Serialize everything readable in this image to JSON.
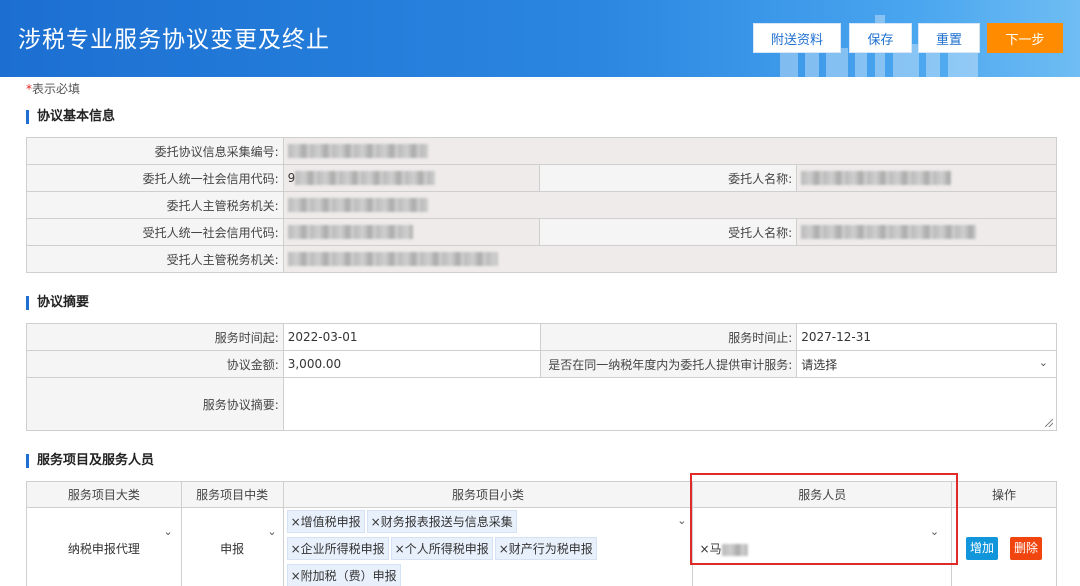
{
  "header": {
    "title": "涉税专业服务协议变更及终止",
    "buttons": {
      "attach": "附送资料",
      "save": "保存",
      "reset": "重置",
      "next": "下一步"
    }
  },
  "required_note": {
    "star": "*",
    "text": "表示必填"
  },
  "basic_info": {
    "title": "协议基本信息",
    "labels": {
      "collect_no": "委托协议信息采集编号:",
      "client_credit_code": "委托人统一社会信用代码:",
      "client_name": "委托人名称:",
      "client_tax_authority": "委托人主管税务机关:",
      "agent_credit_code": "受托人统一社会信用代码:",
      "agent_name": "受托人名称:",
      "agent_tax_authority": "受托人主管税务机关:"
    },
    "client_credit_code_prefix": "9"
  },
  "summary": {
    "title": "协议摘要",
    "labels": {
      "start": "服务时间起:",
      "end": "服务时间止:",
      "amount": "协议金额:",
      "audit": "是否在同一纳税年度内为委托人提供审计服务:",
      "summary": "服务协议摘要:"
    },
    "values": {
      "start": "2022-03-01",
      "end": "2027-12-31",
      "amount": "3,000.00",
      "audit": "请选择"
    }
  },
  "services": {
    "title": "服务项目及服务人员",
    "headers": [
      "服务项目大类",
      "服务项目中类",
      "服务项目小类",
      "服务人员",
      "操作"
    ],
    "row": {
      "major": "纳税申报代理",
      "middle": "申报",
      "minor_tags": [
        "×增值税申报",
        "×财务报表报送与信息采集",
        "×企业所得税申报",
        "×个人所得税申报",
        "×财产行为税申报",
        "×附加税（费）申报"
      ],
      "staff": "×马",
      "add": "增加",
      "delete": "删除"
    }
  },
  "colors": {
    "header_blue": "#1e6fcf",
    "next_orange": "#ff8c00",
    "add_blue": "#1296db",
    "delete_red": "#f0450f",
    "highlight_red": "#e02a2a"
  }
}
